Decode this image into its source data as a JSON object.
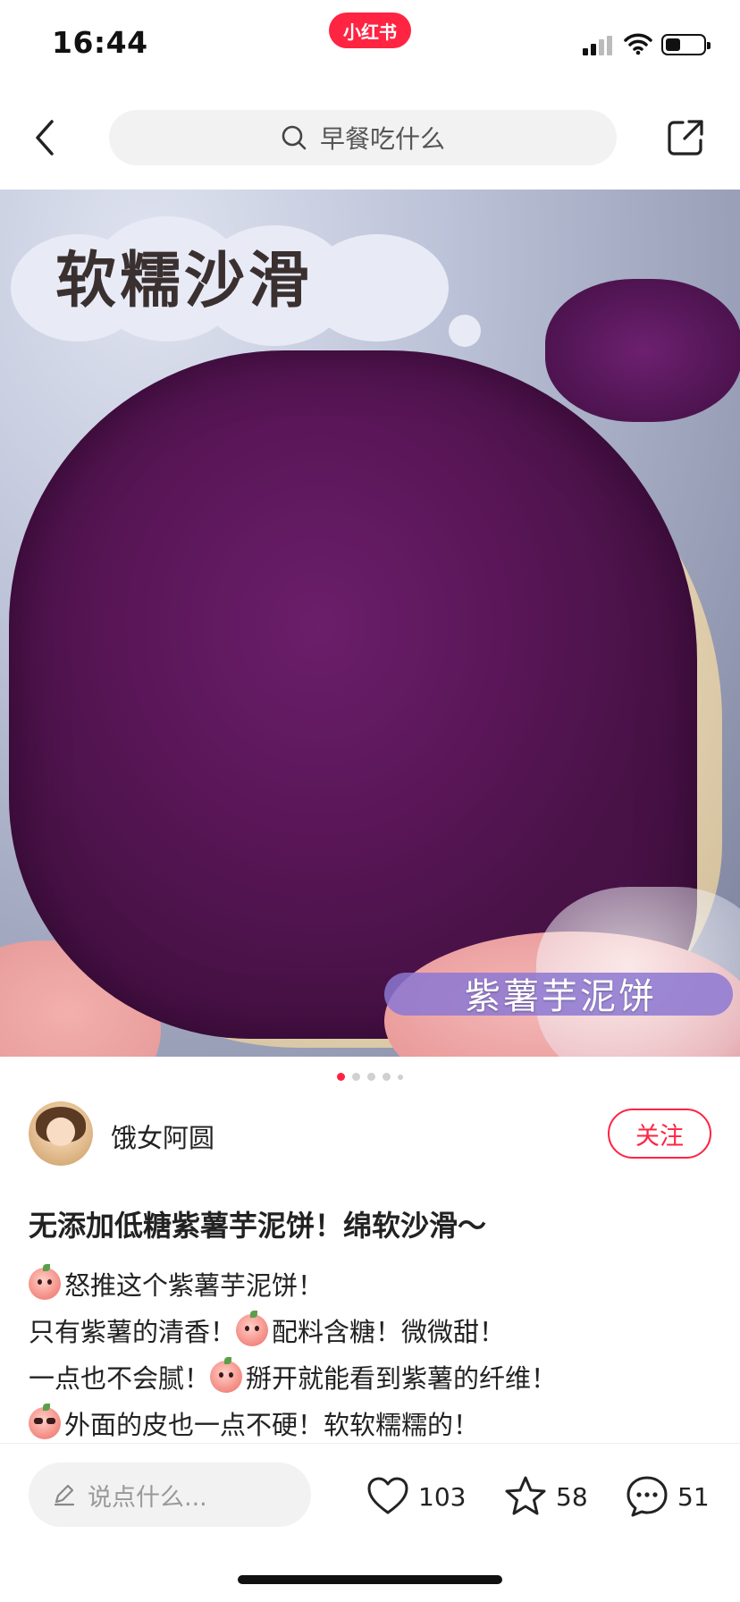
{
  "status_bar": {
    "time": "16:44",
    "app_badge": "小红书"
  },
  "nav": {
    "search_placeholder": "早餐吃什么"
  },
  "image": {
    "overlay_title": "软糯沙滑",
    "overlay_tag": "紫薯芋泥饼",
    "carousel": {
      "total": 5,
      "current": 1
    }
  },
  "author": {
    "name": "饿女阿圆",
    "follow_label": "关注"
  },
  "post": {
    "title": "无添加低糖紫薯芋泥饼！绵软沙滑～",
    "lines": [
      {
        "emoji": "peach-face-icon",
        "text": "怒推这个紫薯芋泥饼！"
      },
      {
        "prefix": "只有紫薯的清香！",
        "emoji": "peach-face-icon",
        "text": "配料含糖！微微甜！"
      },
      {
        "prefix": "一点也不会腻！",
        "emoji": "peach-face-icon",
        "text": "掰开就能看到紫薯的纤维！"
      },
      {
        "emoji": "peach-sunglasses-icon",
        "text": "外面的皮也一点不硬！软软糯糯的！"
      }
    ]
  },
  "bottom_bar": {
    "comment_placeholder": "说点什么...",
    "likes": "103",
    "collects": "58",
    "comments": "51"
  },
  "colors": {
    "brand": "#ff2442",
    "text": "#222222",
    "muted": "#999999"
  }
}
